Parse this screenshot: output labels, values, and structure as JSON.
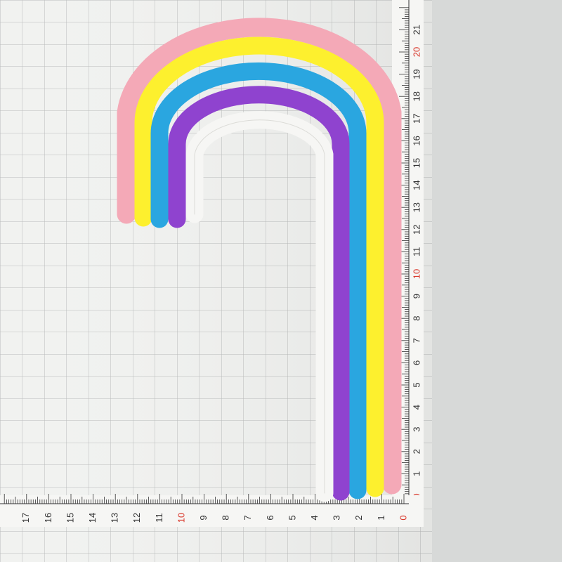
{
  "photo": {
    "subject": "rainbow-straws",
    "straws": [
      {
        "name": "pink-straw",
        "color": "#f4a9b7"
      },
      {
        "name": "yellow-straw",
        "color": "#fdf02e"
      },
      {
        "name": "blue-straw",
        "color": "#2aa6e0"
      },
      {
        "name": "purple-straw",
        "color": "#8f43cf"
      },
      {
        "name": "white-straw",
        "color": "#f6f6f4"
      }
    ],
    "colors": {
      "mat": "#f1f2f0",
      "grid_line": "#b9bbbb",
      "label_red": "#d9382b"
    }
  },
  "ruler_vertical": {
    "labels": [
      "0",
      "1",
      "2",
      "3",
      "4",
      "5",
      "6",
      "7",
      "8",
      "9",
      "10",
      "11",
      "12",
      "13",
      "14",
      "15",
      "16",
      "17",
      "18",
      "19",
      "20",
      "21"
    ],
    "red_labels": [
      "0",
      "10",
      "20"
    ]
  },
  "ruler_horizontal": {
    "labels": [
      "0",
      "1",
      "2",
      "3",
      "4",
      "5",
      "6",
      "7",
      "8",
      "9",
      "10",
      "11",
      "12",
      "13",
      "14",
      "15",
      "16",
      "17"
    ],
    "red_labels": [
      "0",
      "10"
    ]
  }
}
